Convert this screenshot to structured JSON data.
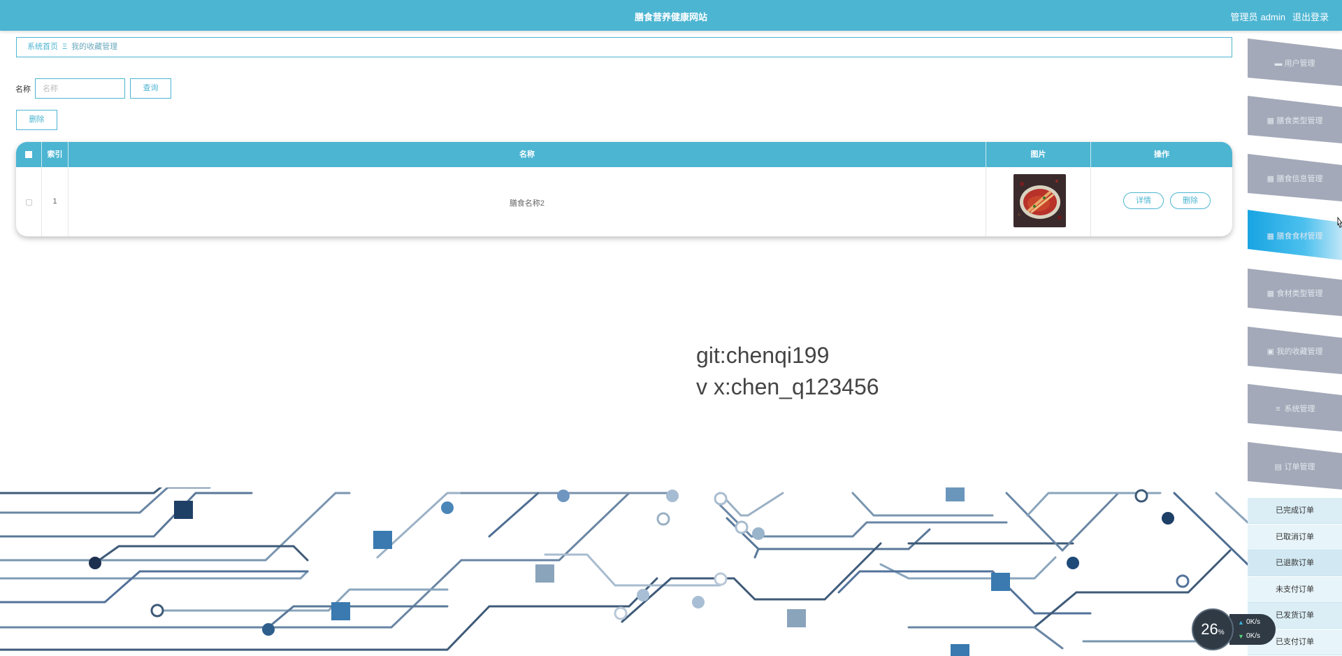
{
  "header": {
    "title": "膳食营养健康网站",
    "role": "管理员",
    "username": "admin",
    "logout": "退出登录"
  },
  "breadcrumb": {
    "home": "系统首页",
    "current": "我的收藏管理"
  },
  "search": {
    "label": "名称",
    "placeholder": "名称",
    "query_button": "查询"
  },
  "toolbar": {
    "delete_button": "删除"
  },
  "table": {
    "columns": [
      "索引",
      "名称",
      "图片",
      "操作"
    ],
    "rows": [
      {
        "index": "1",
        "name": "膳食名称2",
        "detail_button": "详情",
        "delete_button": "删除"
      }
    ]
  },
  "watermark": {
    "line1": "git:chenqi199",
    "line2": "v x:chen_q123456"
  },
  "sidebar": {
    "items": [
      {
        "label": "用户管理",
        "icon": "briefcase-icon",
        "active": false
      },
      {
        "label": "膳食类型管理",
        "icon": "grid-icon",
        "active": false
      },
      {
        "label": "膳食信息管理",
        "icon": "grid-icon",
        "active": false
      },
      {
        "label": "膳食食材管理",
        "icon": "grid-icon",
        "active": true
      },
      {
        "label": "食材类型管理",
        "icon": "grid-icon",
        "active": false
      },
      {
        "label": "我的收藏管理",
        "icon": "clipboard-icon",
        "active": false
      },
      {
        "label": "系统管理",
        "icon": "list-icon",
        "active": false
      },
      {
        "label": "订单管理",
        "icon": "table-icon",
        "active": false
      }
    ],
    "sub_items": [
      "已完成订单",
      "已取消订单",
      "已退款订单",
      "未支付订单",
      "已发货订单",
      "已支付订单"
    ]
  },
  "speed_widget": {
    "percent": "26",
    "percent_unit": "%",
    "upload": "0",
    "download": "0",
    "unit": "K/s"
  },
  "colors": {
    "primary": "#4cb5d2",
    "sidebar_item": "#a3a9b8",
    "sidebar_active": "#2fb3e6",
    "sub_item_bg": "#dbeef6"
  }
}
